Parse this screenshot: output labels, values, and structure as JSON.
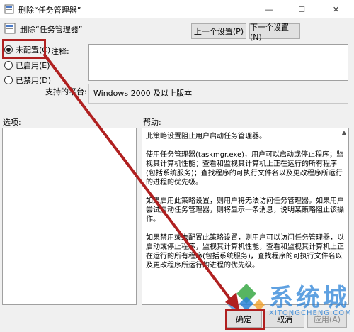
{
  "window": {
    "title": "删除“任务管理器”",
    "minimize_glyph": "—",
    "maximize_glyph": "☐",
    "close_glyph": "✕"
  },
  "header": {
    "policy_title": "删除“任务管理器”",
    "prev_button": "上一个设置(P)",
    "next_button": "下一个设置(N)"
  },
  "state_options": {
    "not_configured": "未配置(C)",
    "enabled": "已启用(E)",
    "disabled": "已禁用(D)",
    "selected": "not_configured"
  },
  "comment_label": "注释:",
  "platform": {
    "label": "支持的平台:",
    "value": "Windows 2000 及以上版本"
  },
  "options_label": "选项:",
  "help_label": "帮助:",
  "help": {
    "p1": "此策略设置阻止用户启动任务管理器。",
    "p2": "使用任务管理器(taskmgr.exe)，用户可以启动或停止程序；监视其计算机性能；查看和监视其计算机上正在运行的所有程序(包括系统服务)；查找程序的可执行文件名以及更改程序所运行的进程的优先级。",
    "p3": "如果启用此策略设置，则用户将无法访问任务管理器。如果用户尝试启动任务管理器，则将显示一条消息，说明某策略阻止该操作。",
    "p4": "如果禁用或未配置此策略设置，则用户可以访问任务管理器，以启动或停止程序，监视其计算机性能，查看和监视其计算机上正在运行的所有程序(包括系统服务)，查找程序的可执行文件名以及更改程序所运行的进程的优先级。"
  },
  "footer": {
    "ok": "确定",
    "cancel": "取消",
    "apply": "应用(A)"
  },
  "watermark": {
    "text": "系统城",
    "url": "XITONGCHENG.COM"
  },
  "colors": {
    "annotation": "#b02020",
    "watermark": "#2a82d8"
  }
}
